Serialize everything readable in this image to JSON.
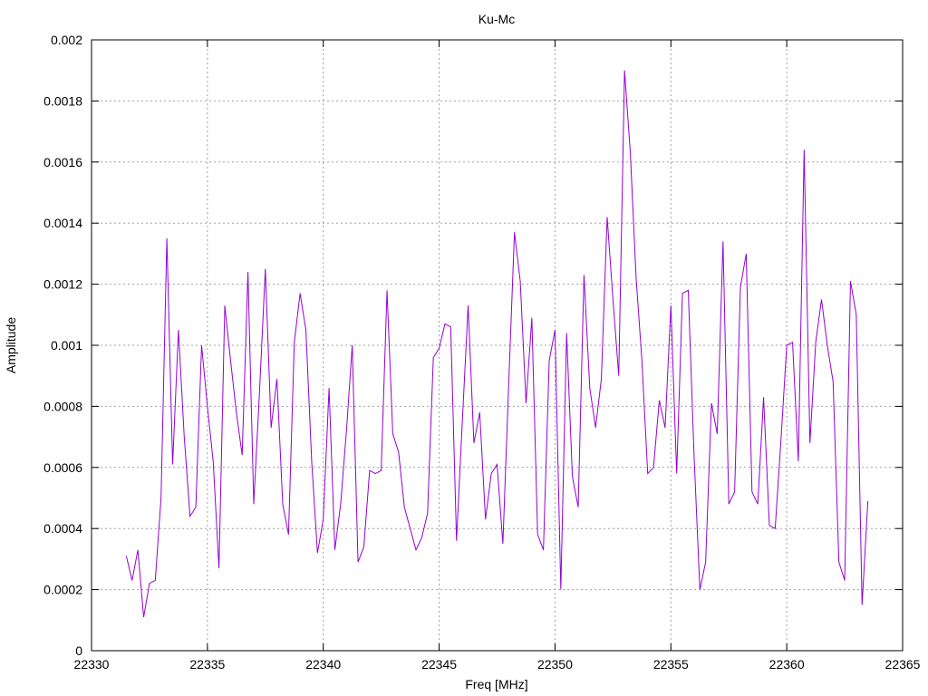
{
  "chart_data": {
    "type": "line",
    "title": "Ku-Mc",
    "xlabel": "Freq [MHz]",
    "ylabel": "Amplitude",
    "xlim": [
      22330,
      22365
    ],
    "ylim": [
      0,
      0.002
    ],
    "x_ticks": [
      {
        "value": 22330,
        "label": "22330"
      },
      {
        "value": 22335,
        "label": "22335"
      },
      {
        "value": 22340,
        "label": "22340"
      },
      {
        "value": 22345,
        "label": "22345"
      },
      {
        "value": 22350,
        "label": "22350"
      },
      {
        "value": 22355,
        "label": "22355"
      },
      {
        "value": 22360,
        "label": "22360"
      },
      {
        "value": 22365,
        "label": "22365"
      }
    ],
    "y_ticks": [
      {
        "value": 0,
        "label": "0"
      },
      {
        "value": 0.0002,
        "label": "0.0002"
      },
      {
        "value": 0.0004,
        "label": "0.0004"
      },
      {
        "value": 0.0006,
        "label": "0.0006"
      },
      {
        "value": 0.0008,
        "label": "0.0008"
      },
      {
        "value": 0.001,
        "label": "0.001"
      },
      {
        "value": 0.0012,
        "label": "0.0012"
      },
      {
        "value": 0.0014,
        "label": "0.0014"
      },
      {
        "value": 0.0016,
        "label": "0.0016"
      },
      {
        "value": 0.0018,
        "label": "0.0018"
      },
      {
        "value": 0.002,
        "label": "0.002"
      }
    ],
    "grid": true,
    "line_color": "#9400d3",
    "series": [
      {
        "x": [
          22331.5,
          22331.75,
          22332,
          22332.25,
          22332.5,
          22332.75,
          22333,
          22333.25,
          22333.5,
          22333.75,
          22334,
          22334.25,
          22334.5,
          22334.75,
          22335,
          22335.25,
          22335.5,
          22335.75,
          22336,
          22336.25,
          22336.5,
          22336.75,
          22337,
          22337.25,
          22337.5,
          22337.75,
          22338,
          22338.25,
          22338.5,
          22338.75,
          22339,
          22339.25,
          22339.5,
          22339.75,
          22340,
          22340.25,
          22340.5,
          22340.75,
          22341,
          22341.25,
          22341.5,
          22341.75,
          22342,
          22342.25,
          22342.5,
          22342.75,
          22343,
          22343.25,
          22343.5,
          22343.75,
          22344,
          22344.25,
          22344.5,
          22344.75,
          22345,
          22345.25,
          22345.5,
          22345.75,
          22346,
          22346.25,
          22346.5,
          22346.75,
          22347,
          22347.25,
          22347.5,
          22347.75,
          22348,
          22348.25,
          22348.5,
          22348.75,
          22349,
          22349.25,
          22349.5,
          22349.75,
          22350,
          22350.25,
          22350.5,
          22350.75,
          22351,
          22351.25,
          22351.5,
          22351.75,
          22352,
          22352.25,
          22352.5,
          22352.75,
          22353,
          22353.25,
          22353.5,
          22353.75,
          22354,
          22354.25,
          22354.5,
          22354.75,
          22355,
          22355.25,
          22355.5,
          22355.75,
          22356,
          22356.25,
          22356.5,
          22356.75,
          22357,
          22357.25,
          22357.5,
          22357.75,
          22358,
          22358.25,
          22358.5,
          22358.75,
          22359,
          22359.25,
          22359.5,
          22359.75,
          22360,
          22360.25,
          22360.5,
          22360.75,
          22361,
          22361.25,
          22361.5,
          22361.75,
          22362,
          22362.25,
          22362.5,
          22362.75,
          22363,
          22363.25,
          22363.5
        ],
        "values": [
          0.00031,
          0.00023,
          0.00033,
          0.00011,
          0.00022,
          0.00023,
          0.0005,
          0.00135,
          0.00061,
          0.00105,
          0.0007,
          0.00044,
          0.00047,
          0.001,
          0.0008,
          0.00062,
          0.00027,
          0.00113,
          0.00095,
          0.00078,
          0.00064,
          0.00124,
          0.00048,
          0.00085,
          0.00125,
          0.00073,
          0.00089,
          0.00048,
          0.00038,
          0.00101,
          0.00117,
          0.00105,
          0.00062,
          0.00032,
          0.00043,
          0.00086,
          0.00033,
          0.00048,
          0.00072,
          0.001,
          0.00029,
          0.00034,
          0.00059,
          0.00058,
          0.00059,
          0.00118,
          0.00071,
          0.00065,
          0.00047,
          0.0004,
          0.00033,
          0.00037,
          0.00045,
          0.00096,
          0.00099,
          0.00107,
          0.00106,
          0.00036,
          0.00075,
          0.00113,
          0.00068,
          0.00078,
          0.00043,
          0.00058,
          0.00061,
          0.00035,
          0.00087,
          0.00137,
          0.00121,
          0.00081,
          0.00109,
          0.00038,
          0.00033,
          0.00095,
          0.00105,
          0.0002,
          0.00104,
          0.00057,
          0.00047,
          0.00123,
          0.00086,
          0.00073,
          0.00089,
          0.00142,
          0.00115,
          0.0009,
          0.0019,
          0.00163,
          0.00122,
          0.00095,
          0.00058,
          0.0006,
          0.00082,
          0.00073,
          0.00113,
          0.00058,
          0.00117,
          0.00118,
          0.00064,
          0.0002,
          0.00029,
          0.00081,
          0.00071,
          0.00134,
          0.00048,
          0.00052,
          0.00119,
          0.0013,
          0.00052,
          0.00048,
          0.00083,
          0.00041,
          0.0004,
          0.00069,
          0.001,
          0.00101,
          0.00062,
          0.00164,
          0.00068,
          0.00101,
          0.00115,
          0.001,
          0.00088,
          0.00029,
          0.00023,
          0.00121,
          0.0011,
          0.00015,
          0.00049
        ]
      }
    ]
  }
}
